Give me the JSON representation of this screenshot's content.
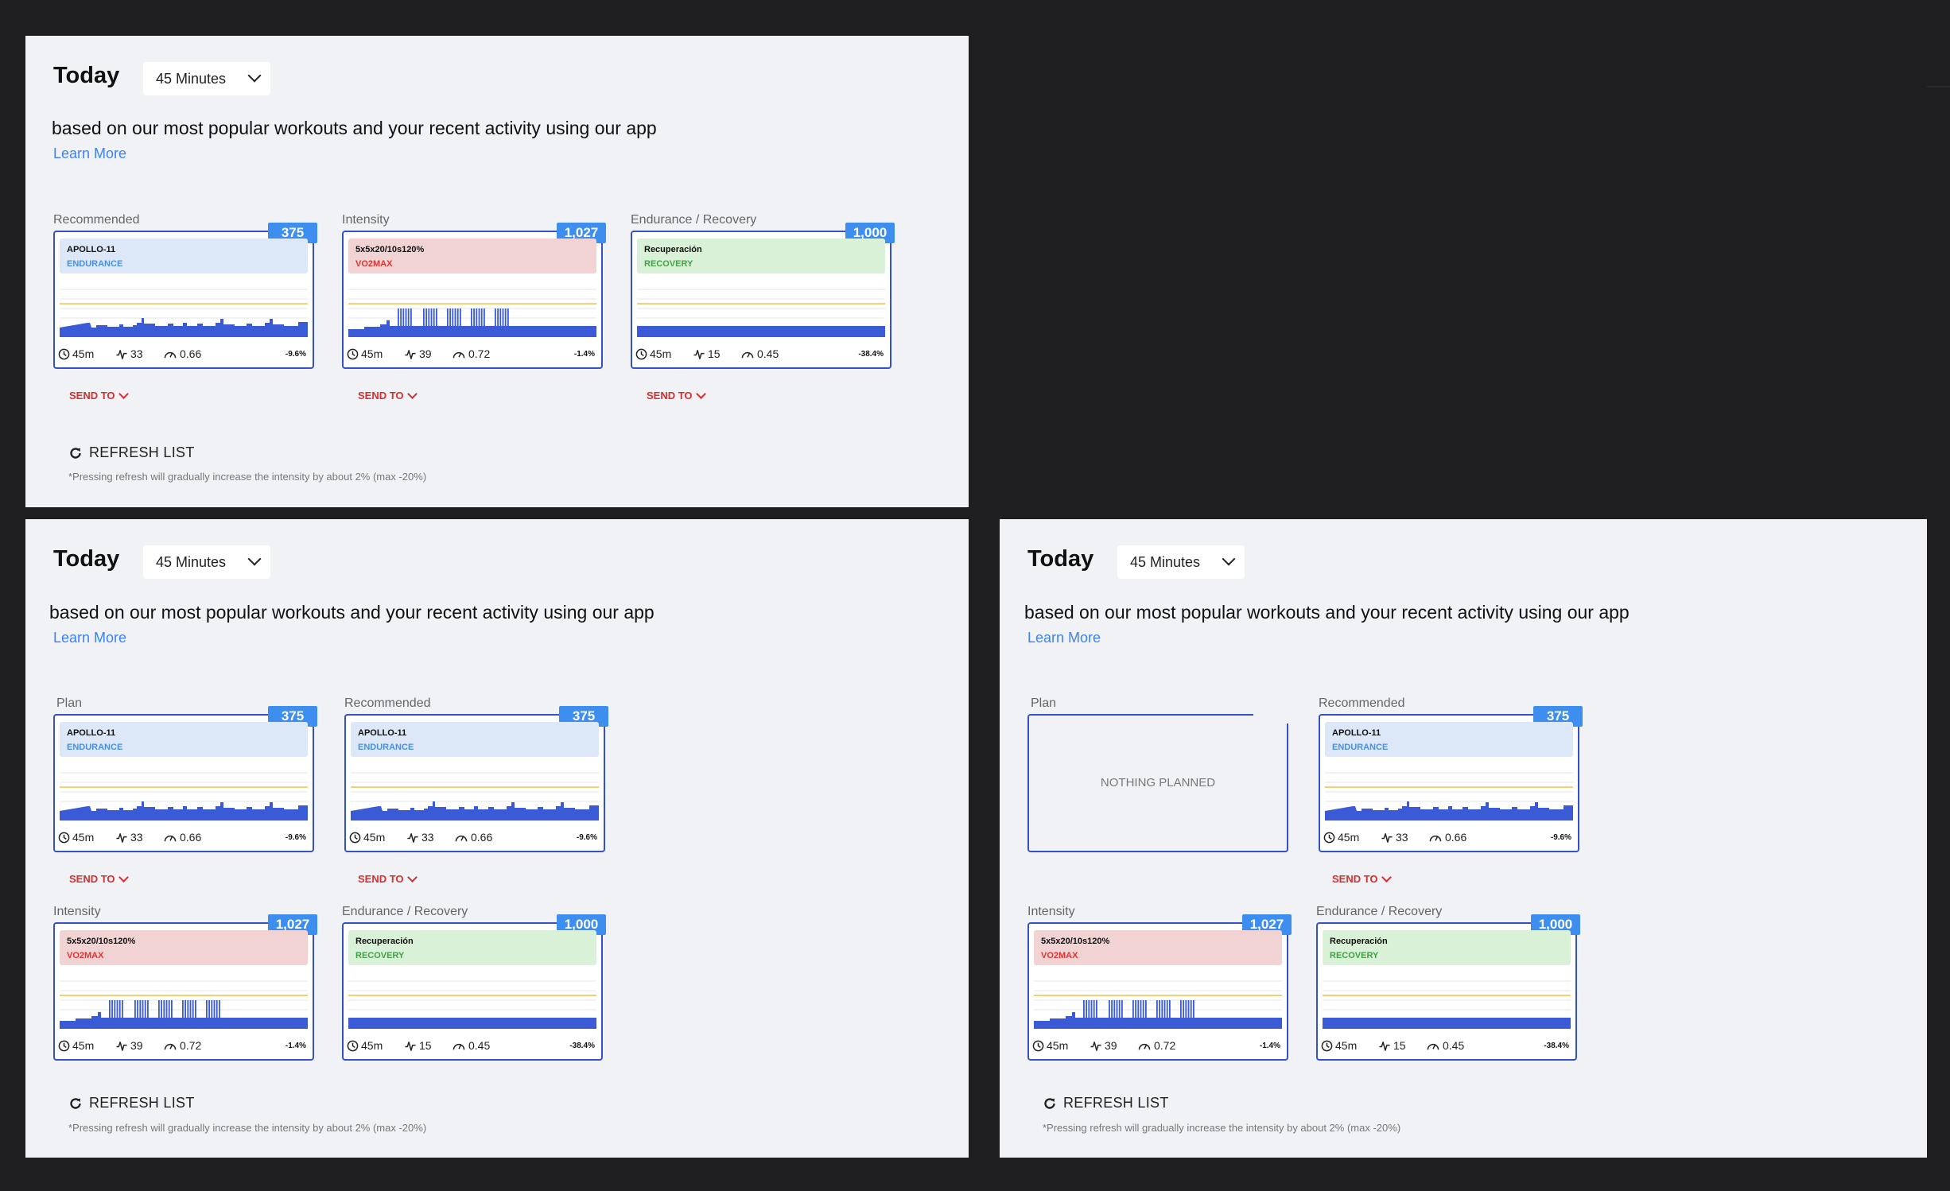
{
  "today_label": "Today",
  "duration_value": "45 Minutes",
  "description": "based on our most popular workouts and your recent activity using our app",
  "learn_more": "Learn More",
  "send_to": "SEND TO",
  "refresh": "REFRESH LIST",
  "refresh_note": "*Pressing refresh will gradually increase the intensity by about 2% (max -20%)",
  "nothing_planned": "NOTHING PLANNED",
  "section_labels": {
    "recommended": "Recommended",
    "intensity": "Intensity",
    "endurance": "Endurance / Recovery",
    "plan": "Plan"
  },
  "workouts": {
    "apollo": {
      "score": "375",
      "name": "APOLLO-11",
      "type": "ENDURANCE",
      "color": "blue",
      "duration": "45m",
      "tss": "33",
      "if": "0.66",
      "pct": "-9.6%",
      "profile": "endurance"
    },
    "vo2": {
      "score": "1,027",
      "name": "5x5x20/10s120%",
      "type": "VO2MAX",
      "color": "red",
      "duration": "45m",
      "tss": "39",
      "if": "0.72",
      "pct": "-1.4%",
      "profile": "vo2"
    },
    "recovery": {
      "score": "1,000",
      "name": "Recuperación",
      "type": "RECOVERY",
      "color": "green",
      "duration": "45m",
      "tss": "15",
      "if": "0.45",
      "pct": "-38.4%",
      "profile": "flat"
    }
  },
  "colors": {
    "accent": "#3e8ef0",
    "bars": "#3a5ad6",
    "ftp_line": "#f0c040",
    "send": "#d32f2f"
  }
}
